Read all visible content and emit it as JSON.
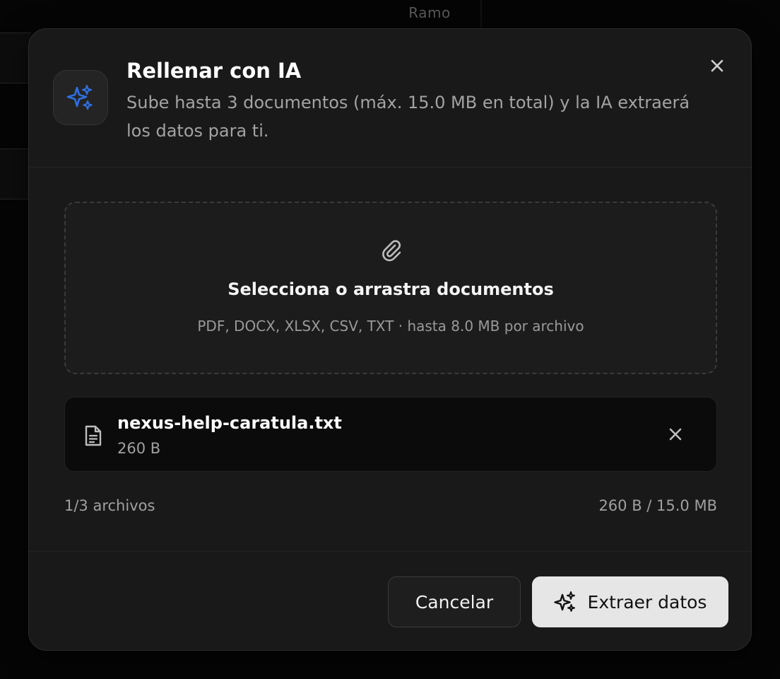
{
  "background": {
    "column_label": "Ramo"
  },
  "modal": {
    "title": "Rellenar con IA",
    "subtitle": "Sube hasta 3 documentos (máx. 15.0 MB en total) y la IA extraerá los datos para ti.",
    "badge_icon": "sparkles-icon",
    "close_icon": "close-icon"
  },
  "dropzone": {
    "icon": "paperclip-icon",
    "title": "Selecciona o arrastra documentos",
    "hint": "PDF, DOCX, XLSX, CSV, TXT · hasta 8.0 MB por archivo"
  },
  "files": [
    {
      "name": "nexus-help-caratula.txt",
      "size": "260 B",
      "icon": "document-icon"
    }
  ],
  "summary": {
    "count": "1/3 archivos",
    "total": "260 B / 15.0 MB"
  },
  "footer": {
    "cancel_label": "Cancelar",
    "extract_label": "Extraer datos"
  },
  "colors": {
    "accent": "#2f6fe0",
    "modal_bg": "#191919",
    "primary_button_bg": "#e6e6e6"
  }
}
